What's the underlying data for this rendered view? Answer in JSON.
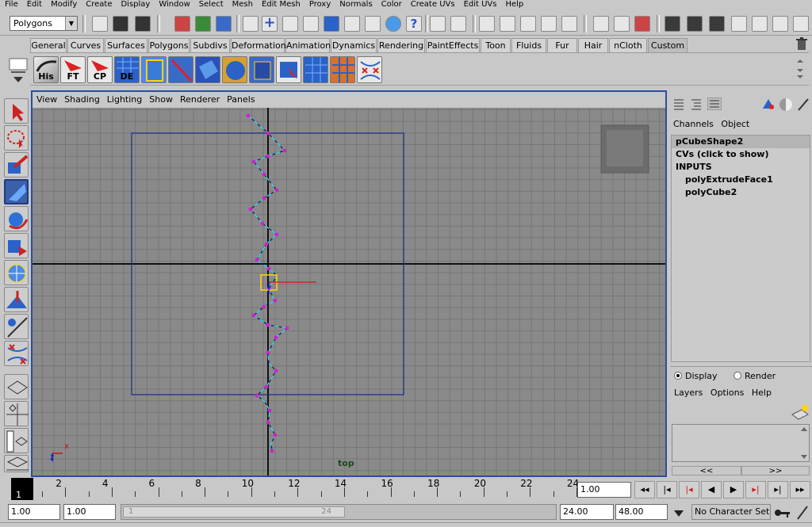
{
  "menubar": [
    "File",
    "Edit",
    "Modify",
    "Create",
    "Display",
    "Window",
    "Select",
    "Mesh",
    "Edit Mesh",
    "Proxy",
    "Normals",
    "Color",
    "Create UVs",
    "Edit UVs",
    "Help"
  ],
  "status_line": {
    "mode": "Polygons"
  },
  "shelf": {
    "tabs": [
      "General",
      "Curves",
      "Surfaces",
      "Polygons",
      "Subdivs",
      "Deformation",
      "Animation",
      "Dynamics",
      "Rendering",
      "PaintEffects",
      "Toon",
      "Fluids",
      "Fur",
      "Hair",
      "nCloth",
      "Custom"
    ],
    "active_tab": "Custom",
    "icons": [
      {
        "label": "His",
        "icon": "history-icon"
      },
      {
        "label": "FT",
        "icon": "freeze-transform-icon"
      },
      {
        "label": "CP",
        "icon": "center-pivot-icon"
      },
      {
        "label": "DE",
        "icon": "delete-edge-icon"
      },
      {
        "label": "",
        "icon": "uv-layout-icon"
      },
      {
        "label": "",
        "icon": "cut-uv-icon"
      },
      {
        "label": "",
        "icon": "planar-map-icon"
      },
      {
        "label": "",
        "icon": "sphere-map-icon"
      },
      {
        "label": "",
        "icon": "cylinder-map-icon"
      },
      {
        "label": "",
        "icon": "select-face-icon"
      },
      {
        "label": "",
        "icon": "grid-uv-icon"
      },
      {
        "label": "",
        "icon": "unfold-uv-icon"
      },
      {
        "label": "",
        "icon": "sew-uv-icon"
      }
    ]
  },
  "viewport": {
    "menu": [
      "View",
      "Shading",
      "Lighting",
      "Show",
      "Renderer",
      "Panels"
    ],
    "camera": "top",
    "axis_labels": {
      "x": "x",
      "z": "z"
    }
  },
  "channel_box": {
    "menu": [
      "Channels",
      "Object"
    ],
    "items": [
      {
        "label": "pCubeShape2",
        "selected": true,
        "indent": false
      },
      {
        "label": "CVs (click to show)",
        "selected": false,
        "indent": false
      },
      {
        "label": "INPUTS",
        "selected": false,
        "indent": false
      },
      {
        "label": "polyExtrudeFace1",
        "selected": false,
        "indent": true
      },
      {
        "label": "polyCube2",
        "selected": false,
        "indent": true
      }
    ]
  },
  "layer_editor": {
    "display_label": "Display",
    "render_label": "Render",
    "menu": [
      "Layers",
      "Options",
      "Help"
    ],
    "nav_prev": "<<",
    "nav_next": ">>"
  },
  "time_slider": {
    "current_frame": "1",
    "tick_labels": [
      "2",
      "4",
      "6",
      "8",
      "10",
      "12",
      "14",
      "16",
      "18",
      "20",
      "22",
      "24"
    ],
    "current_time": "1.00"
  },
  "range_slider": {
    "start_time": "1.00",
    "range_start": "1.00",
    "range_slider_start": "1",
    "range_slider_end": "24",
    "range_end": "24.00",
    "end_time": "48.00",
    "character_set": "No Character Set"
  }
}
